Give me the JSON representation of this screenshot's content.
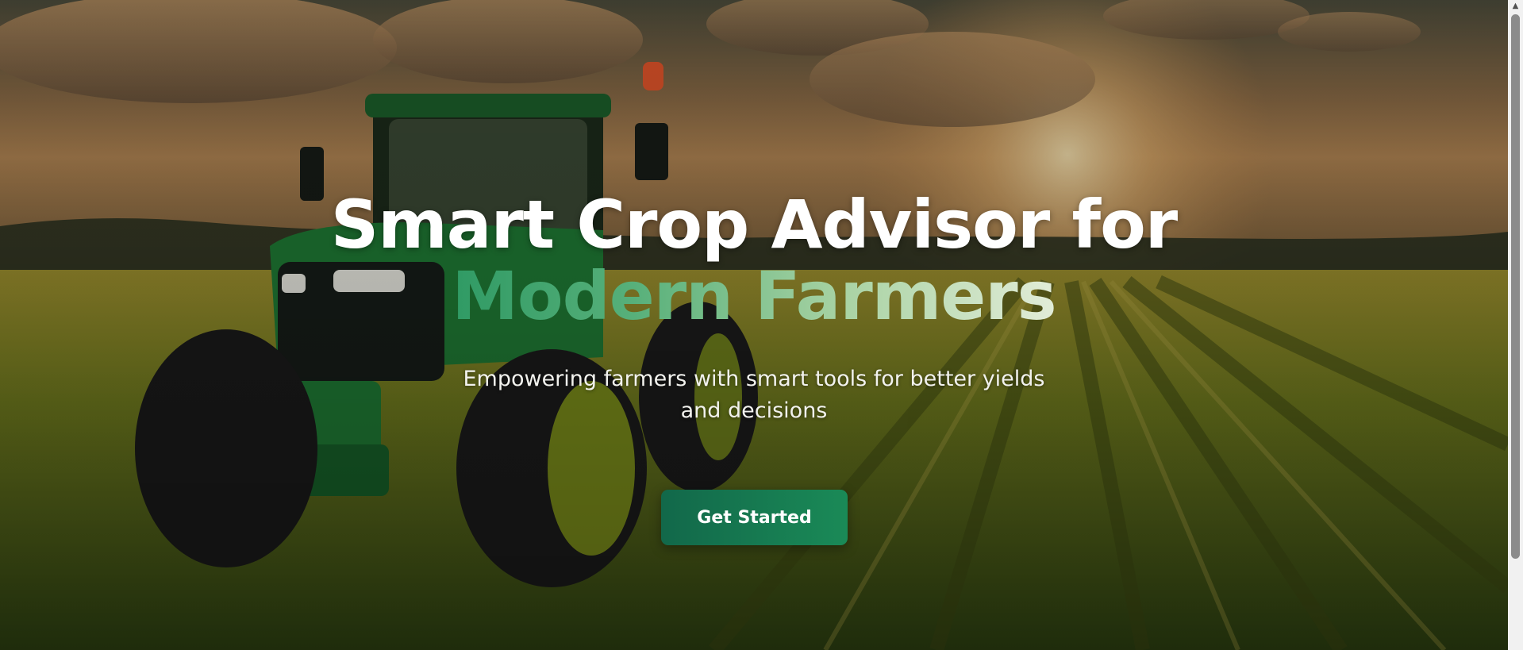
{
  "hero": {
    "headline_line1": "Smart Crop Advisor for",
    "headline_line2": "Modern Farmers",
    "subtitle": "Empowering farmers with smart tools for better yields and decisions",
    "cta_label": "Get Started",
    "background_image": "tractor-in-wheat-field-at-sunset"
  },
  "colors": {
    "accent_start": "#2f9a64",
    "accent_end": "#e2ecd8",
    "button_start": "#12684a",
    "button_end": "#1a8a57",
    "headline": "#ffffff"
  },
  "scrollbar": {
    "up_icon": "scroll-up-arrow-icon"
  }
}
